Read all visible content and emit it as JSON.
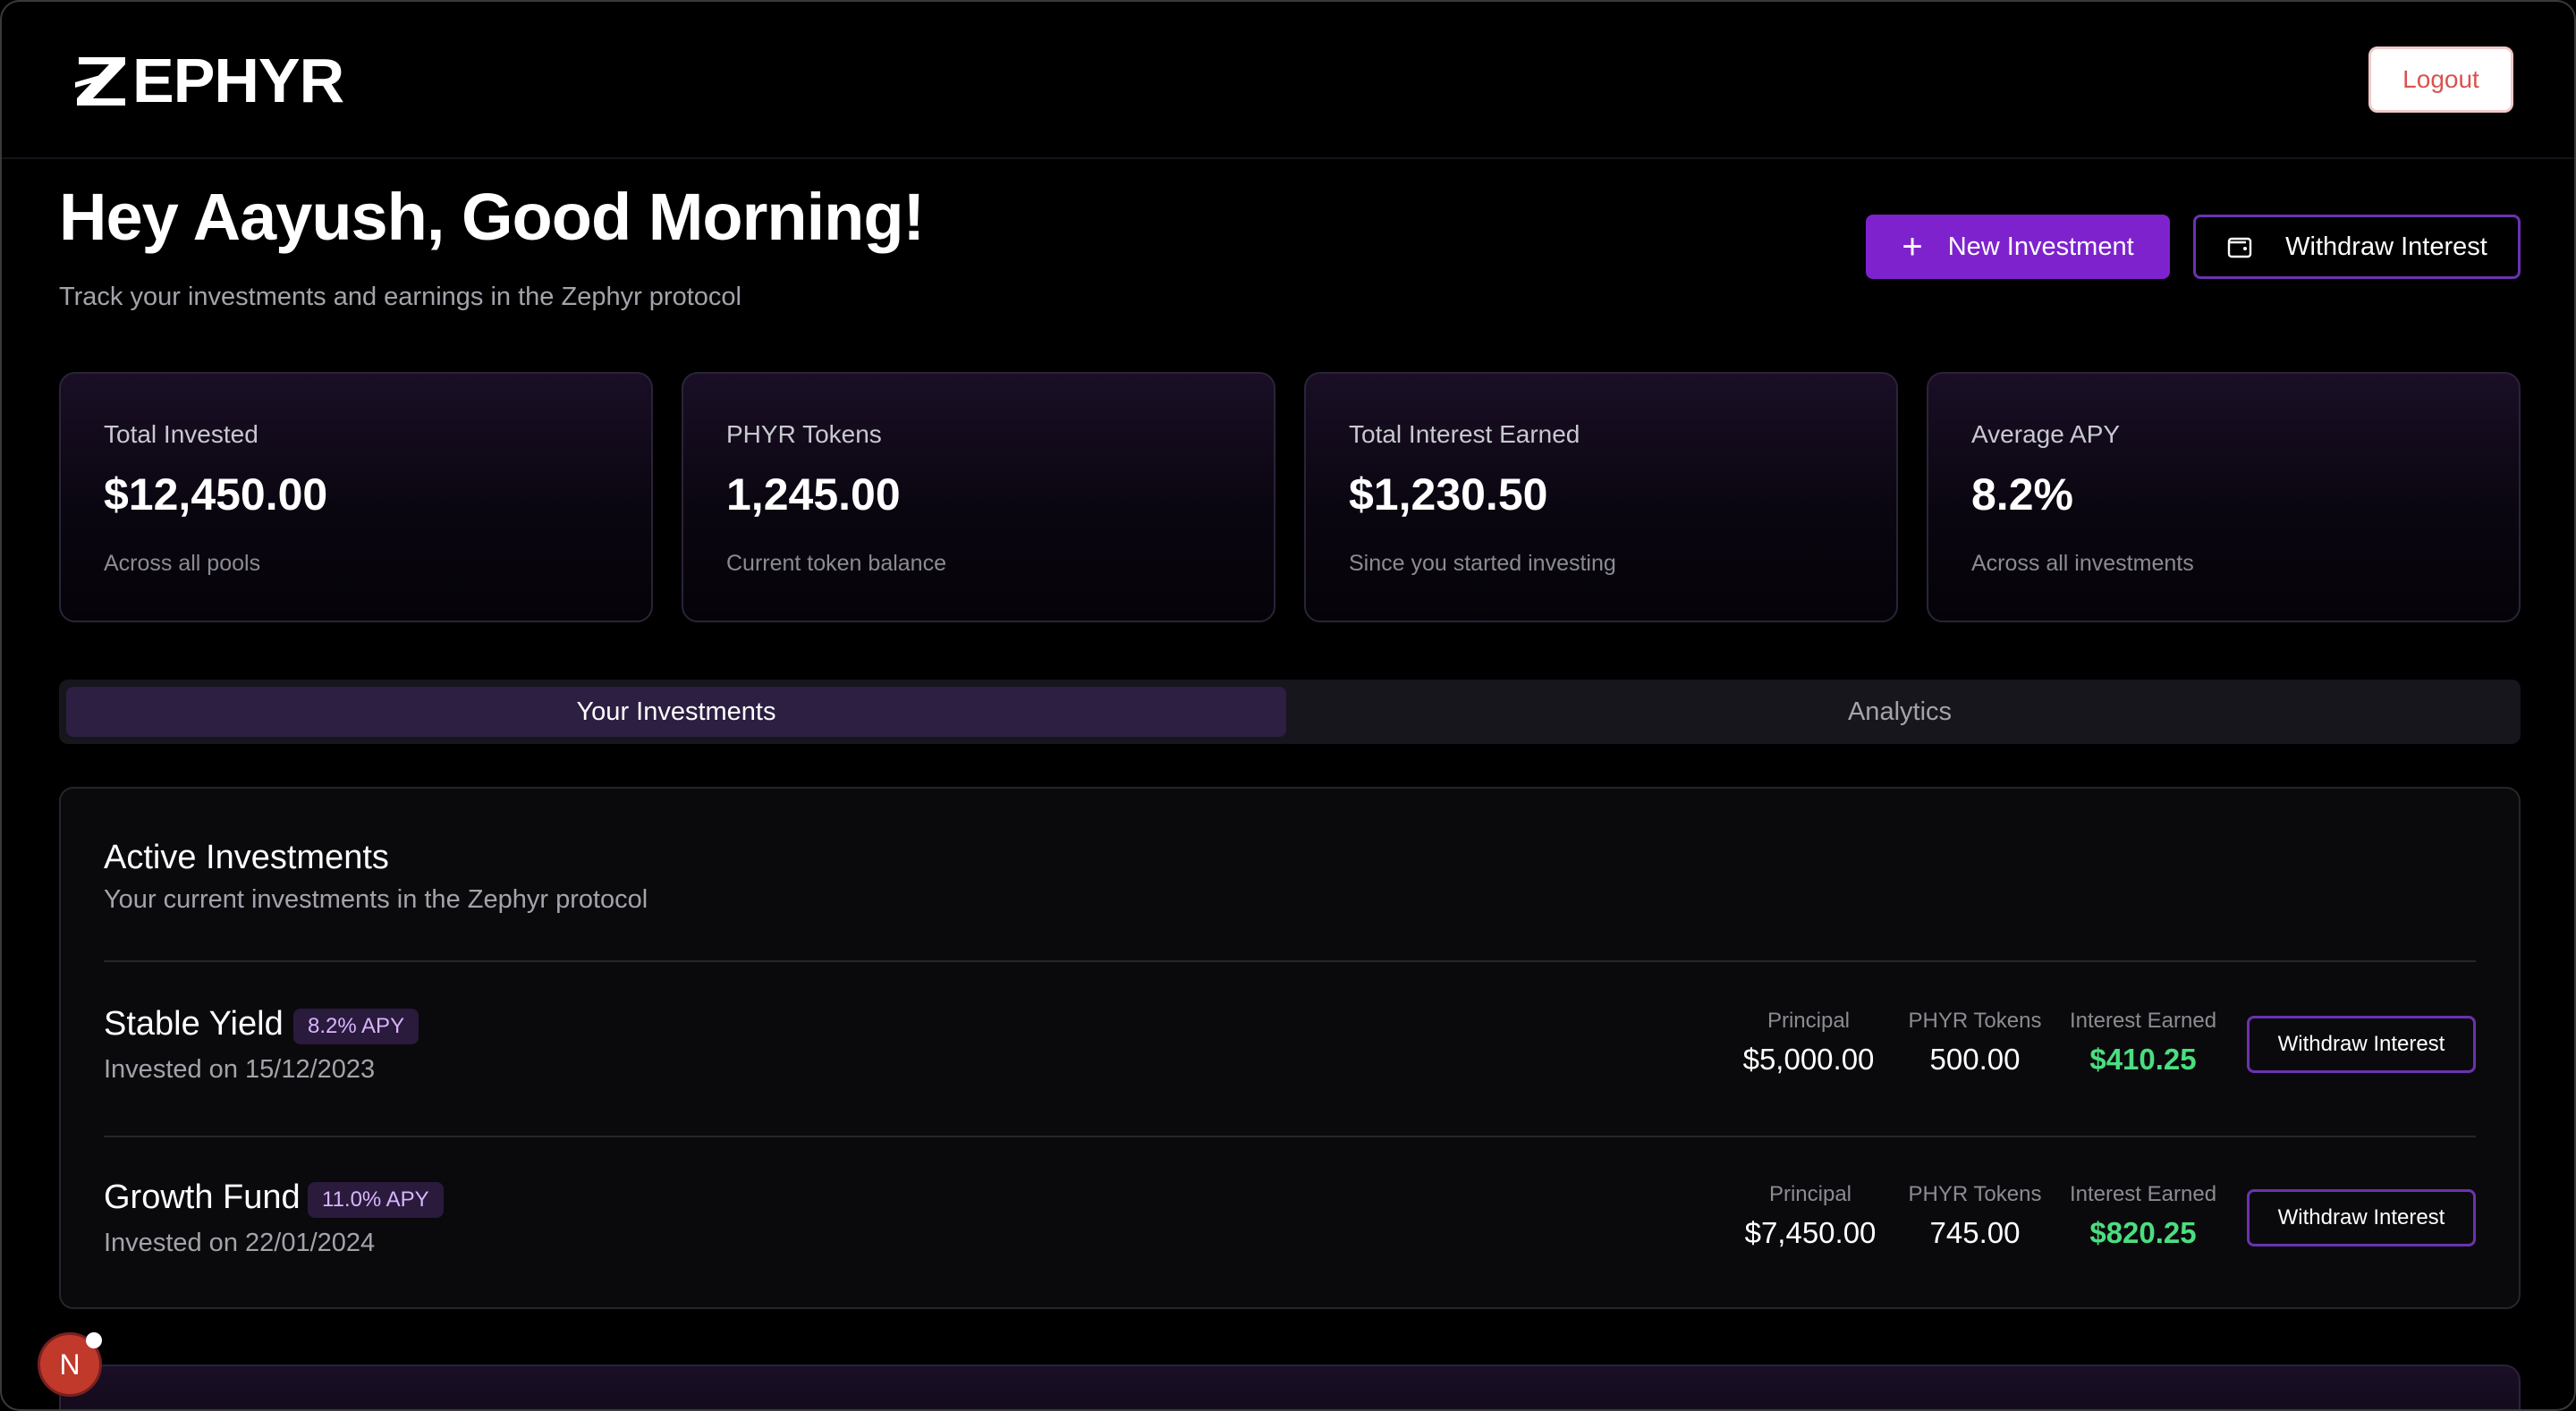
{
  "header": {
    "logo_text": "EPHYR",
    "logout_label": "Logout"
  },
  "greeting": {
    "title": "Hey Aayush, Good Morning!",
    "subtitle": "Track your investments and earnings in the Zephyr protocol"
  },
  "actions": {
    "new_investment_label": "New Investment",
    "withdraw_interest_label": "Withdraw Interest"
  },
  "stats": [
    {
      "label": "Total Invested",
      "value": "$12,450.00",
      "note": "Across all pools"
    },
    {
      "label": "PHYR Tokens",
      "value": "1,245.00",
      "note": "Current token balance"
    },
    {
      "label": "Total Interest Earned",
      "value": "$1,230.50",
      "note": "Since you started investing"
    },
    {
      "label": "Average APY",
      "value": "8.2%",
      "note": "Across all investments"
    }
  ],
  "tabs": [
    {
      "label": "Your Investments",
      "active": true
    },
    {
      "label": "Analytics",
      "active": false
    }
  ],
  "panel": {
    "title": "Active Investments",
    "subtitle": "Your current investments in the Zephyr protocol",
    "columns": {
      "principal": "Principal",
      "tokens": "PHYR Tokens",
      "interest": "Interest Earned"
    },
    "investments": [
      {
        "name": "Stable Yield",
        "apy": "8.2% APY",
        "date": "Invested on 15/12/2023",
        "principal": "$5,000.00",
        "tokens": "500.00",
        "interest": "$410.25",
        "button": "Withdraw Interest"
      },
      {
        "name": "Growth Fund",
        "apy": "11.0% APY",
        "date": "Invested on 22/01/2024",
        "principal": "$7,450.00",
        "tokens": "745.00",
        "interest": "$820.25",
        "button": "Withdraw Interest"
      }
    ]
  },
  "dev_badge": {
    "letter": "N"
  },
  "colors": {
    "accent": "#7e22ce",
    "accent_border": "#6b32b0",
    "positive": "#4ade80",
    "logout_text": "#d9534f"
  },
  "icons": [
    "zephyr-logo-icon",
    "plus-icon",
    "wallet-icon"
  ]
}
